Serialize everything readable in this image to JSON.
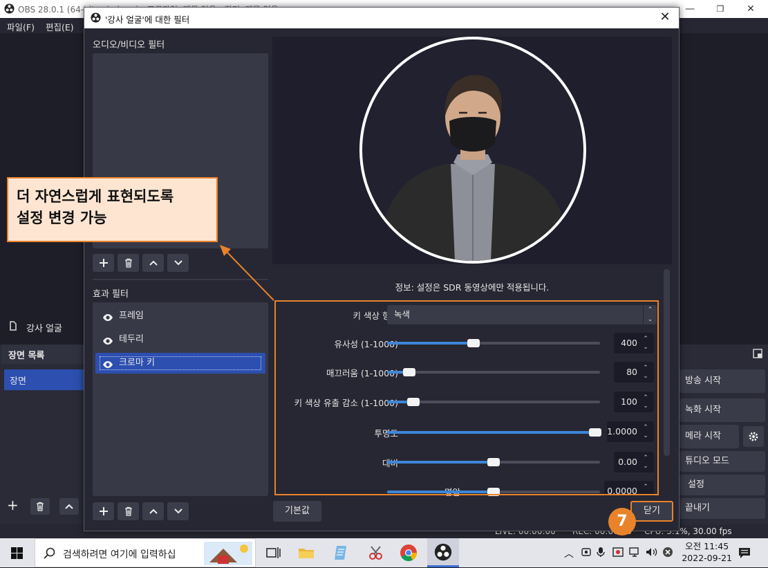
{
  "main_window": {
    "title": "OBS 28.0.1 (64-bit, windows) - 프로파일: 제목 없음 - 장면: 제목 없음",
    "menu": [
      "파일(F)",
      "편집(E)"
    ],
    "source_item": "강사 얼굴",
    "scenes_header": "장면 목록",
    "scene_item": "장면",
    "controls": {
      "stream": "방송 시작",
      "record": "녹화 시작",
      "vcam": "메라 시작",
      "studio": "튜디오 모드",
      "settings": "설정",
      "exit": "끝내기"
    },
    "status": {
      "live": "LIVE: 00:00:00",
      "rec": "REC: 00:00:00",
      "cpu": "CPU: 3.1%, 30.00 fps"
    }
  },
  "dialog": {
    "title": "'강사 얼굴'에 대한 필터",
    "audio_video_label": "오디오/비디오 필터",
    "effect_label": "효과 필터",
    "effect_filters": [
      {
        "label": "프레임",
        "selected": false
      },
      {
        "label": "테두리",
        "selected": false
      },
      {
        "label": "크로마 키",
        "selected": true
      }
    ],
    "info": "정보: 설정은 SDR 동영상에만 적용됩니다.",
    "properties": {
      "key_color_type": {
        "label": "키 색상 형식",
        "value": "녹색"
      },
      "similarity": {
        "label": "유사성 (1-1000)",
        "value": "400",
        "min": 1,
        "max": 1000
      },
      "smoothness": {
        "label": "매끄러움 (1-1000)",
        "value": "80",
        "min": 1,
        "max": 1000
      },
      "spill": {
        "label": "키 색상 유출 감소 (1-1000)",
        "value": "100",
        "min": 1,
        "max": 1000
      },
      "opacity": {
        "label": "투명도",
        "value": "1.0000",
        "fraction": 1.0
      },
      "contrast": {
        "label": "대비",
        "value": "0.00",
        "fraction": 0.5
      },
      "brightness": {
        "label": "명암",
        "value": "0.0000",
        "fraction": 0.5
      }
    },
    "defaults_button": "기본값",
    "close_button": "닫기"
  },
  "annotation": {
    "callout_line1": "더 자연스럽게 표현되도록",
    "callout_line2": "설정 변경 가능",
    "step_number": "7",
    "accent_color": "#e8832b"
  },
  "taskbar": {
    "search_placeholder": "검색하려면 여기에 입력하십",
    "time": "오전 11:45",
    "date": "2022-09-21"
  }
}
